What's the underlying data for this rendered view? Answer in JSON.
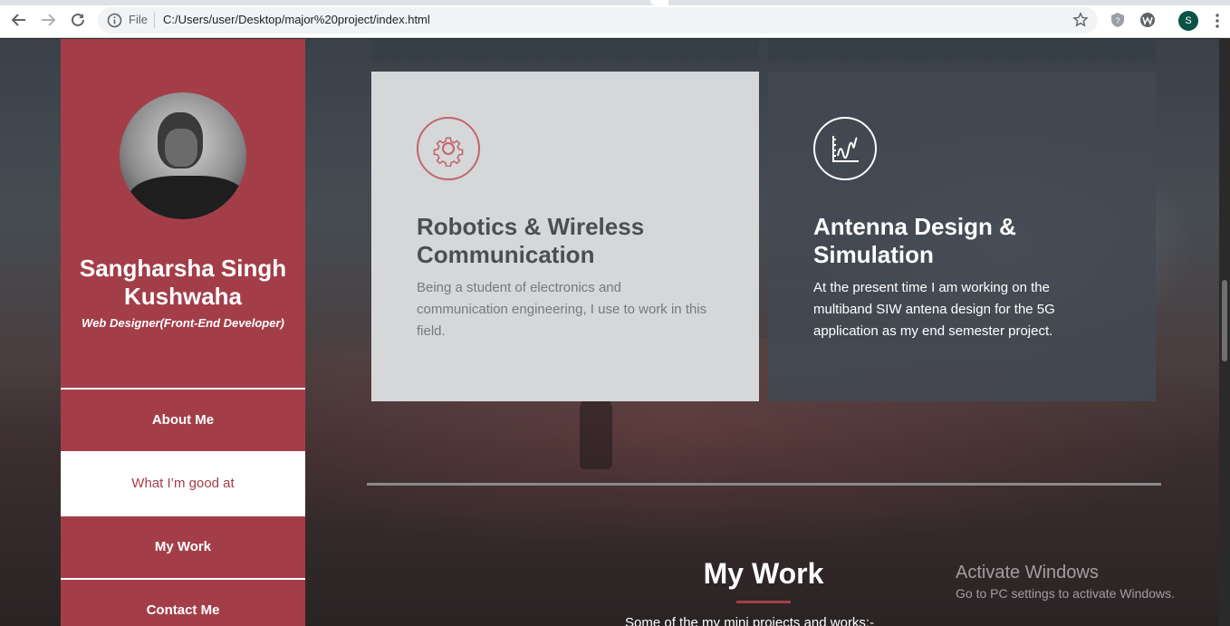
{
  "browser": {
    "file_label": "File",
    "url": "C:/Users/user/Desktop/major%20project/index.html",
    "profile_initial": "S"
  },
  "profile": {
    "name": "Sangharsha Singh Kushwaha",
    "role": "Web Designer(Front-End Developer)"
  },
  "menu": [
    {
      "label": "About Me"
    },
    {
      "label": "What I’m good at"
    },
    {
      "label": "My Work"
    },
    {
      "label": "Contact Me"
    }
  ],
  "cards": [
    {
      "icon": "gear-icon",
      "title": "Robotics & Wireless Communication",
      "text": "Being a student of electronics and communication engineering, I use to work in this field."
    },
    {
      "icon": "chart-icon",
      "title": "Antenna Design & Simulation",
      "text": "At the present time I am working on the multiband SIW antena design for the 5G application as my end semester project."
    }
  ],
  "work": {
    "title": "My Work",
    "subtitle": "Some of the my mini projects and works:-"
  },
  "watermark": {
    "title": "Activate Windows",
    "subtitle": "Go to PC settings to activate Windows."
  },
  "colors": {
    "accent": "#a33e48",
    "light_card": "#d6d7d9"
  }
}
